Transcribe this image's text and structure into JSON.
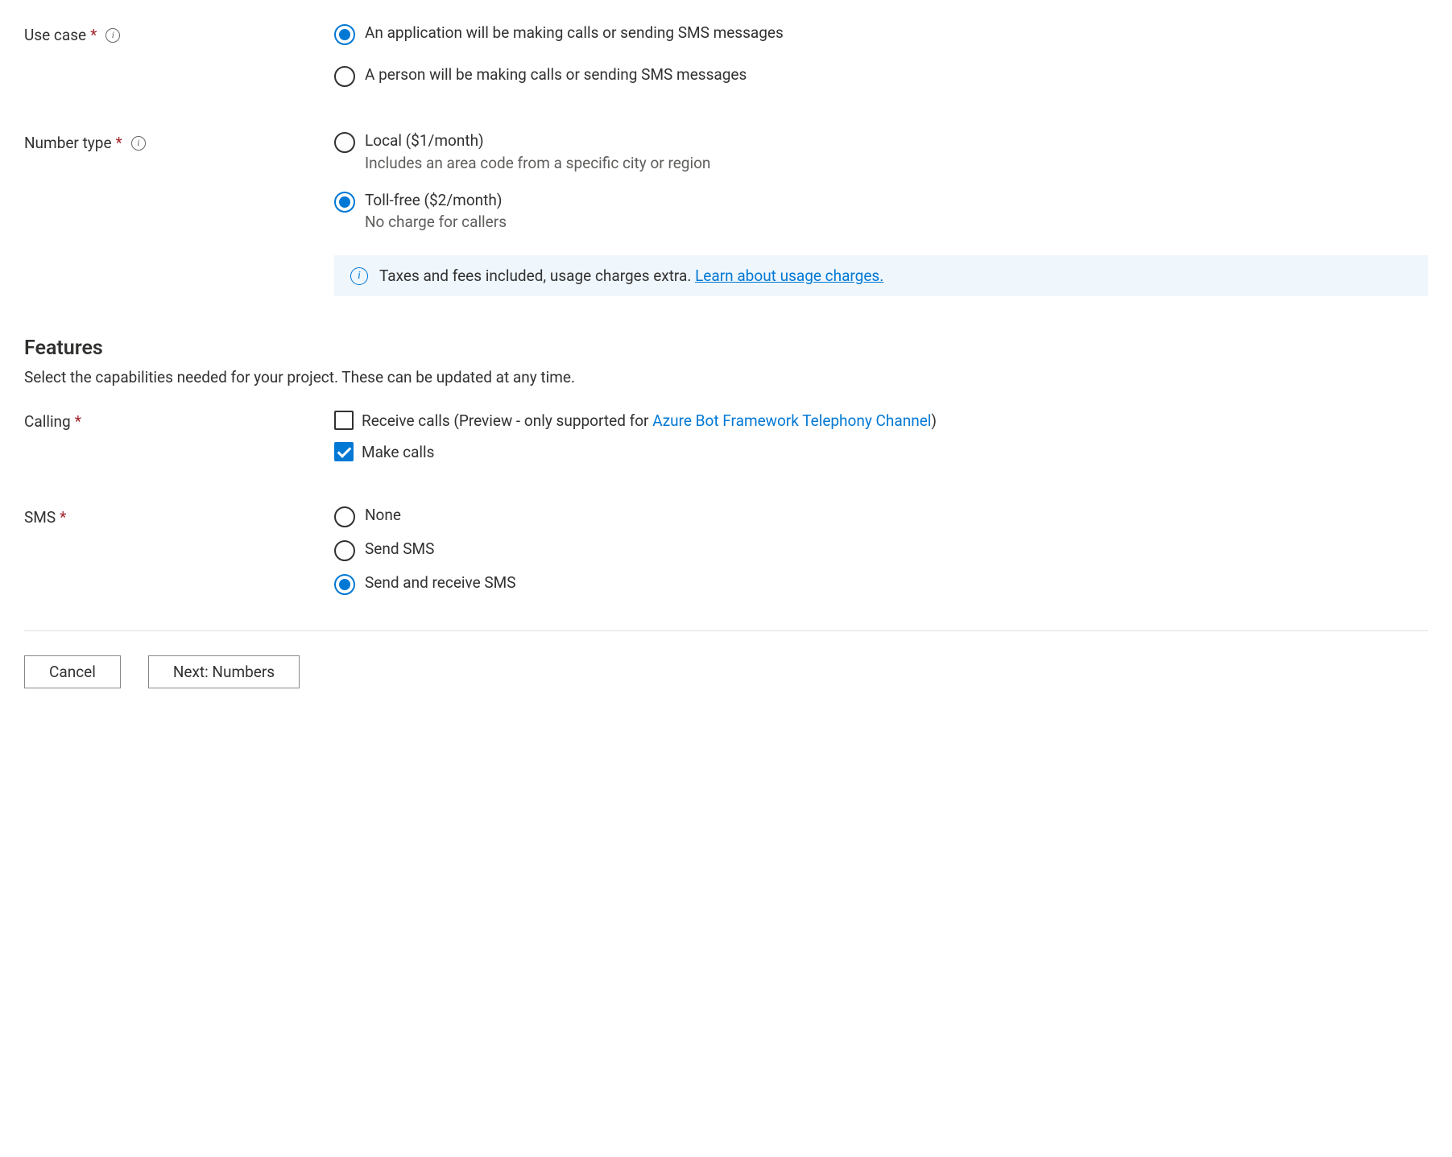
{
  "useCase": {
    "label": "Use case",
    "options": {
      "application": "An application will be making calls or sending SMS messages",
      "person": "A person will be making calls or sending SMS messages"
    }
  },
  "numberType": {
    "label": "Number type",
    "options": {
      "local": {
        "title": "Local ($1/month)",
        "desc": "Includes an area code from a specific city or region"
      },
      "tollFree": {
        "title": "Toll-free ($2/month)",
        "desc": "No charge for callers"
      }
    }
  },
  "callout": {
    "text": "Taxes and fees included, usage charges extra. ",
    "link": "Learn about usage charges."
  },
  "features": {
    "title": "Features",
    "desc": "Select the capabilities needed for your project. These can be updated at any time."
  },
  "calling": {
    "label": "Calling",
    "receive": {
      "prefix": "Receive calls (Preview - only supported for ",
      "link": "Azure Bot Framework Telephony Channel",
      "suffix": ")"
    },
    "make": "Make calls"
  },
  "sms": {
    "label": "SMS",
    "options": {
      "none": "None",
      "send": "Send SMS",
      "sendReceive": "Send and receive SMS"
    }
  },
  "buttons": {
    "cancel": "Cancel",
    "next": "Next: Numbers"
  }
}
